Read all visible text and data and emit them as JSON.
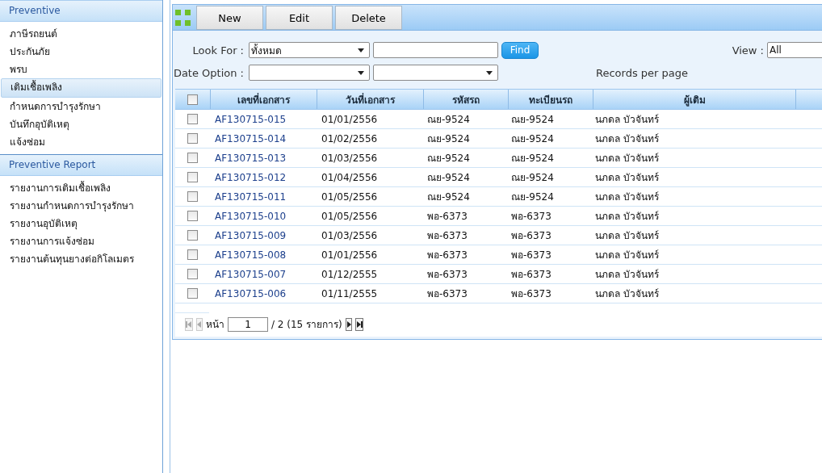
{
  "sidebar": {
    "sections": [
      {
        "title": "Preventive",
        "items": [
          {
            "label": "ภาษีรถยนต์",
            "selected": false
          },
          {
            "label": "ประกันภัย",
            "selected": false
          },
          {
            "label": "พรบ",
            "selected": false
          },
          {
            "label": "เติมเชื้อเพลิง",
            "selected": true
          },
          {
            "label": "กำหนดการบำรุงรักษา",
            "selected": false
          },
          {
            "label": "บันทึกอุบัติเหตุ",
            "selected": false
          },
          {
            "label": "แจ้งซ่อม",
            "selected": false
          }
        ]
      },
      {
        "title": "Preventive Report",
        "items": [
          {
            "label": "รายงานการเติมเชื้อเพลิง",
            "selected": false
          },
          {
            "label": "รายงานกำหนดการบำรุงรักษา",
            "selected": false
          },
          {
            "label": "รายงานอุบัติเหตุ",
            "selected": false
          },
          {
            "label": "รายงานการแจ้งซ่อม",
            "selected": false
          },
          {
            "label": "รายงานต้นทุนยางต่อกิโลเมตร",
            "selected": false
          }
        ]
      }
    ]
  },
  "toolbar": {
    "buttons": [
      "New",
      "Edit",
      "Delete"
    ]
  },
  "filters": {
    "look_for": {
      "label": "Look For :",
      "value": "ทั้งหมด"
    },
    "find_button": "Find",
    "date_option": {
      "label": "Date Option :"
    },
    "view": {
      "label": "View :",
      "value": "All"
    },
    "records_per_page": "Records per page"
  },
  "table": {
    "columns": [
      "เลขที่เอกสาร",
      "วันที่เอกสาร",
      "รหัสรถ",
      "ทะเบียนรถ",
      "ผู้เติม"
    ],
    "header_checked": false,
    "rows": [
      {
        "checked": false,
        "cells": [
          "AF130715-015",
          "01/01/2556",
          "ณย-9524",
          "ณย-9524",
          "นภดล บัวจันทร์"
        ]
      },
      {
        "checked": false,
        "cells": [
          "AF130715-014",
          "01/02/2556",
          "ณย-9524",
          "ณย-9524",
          "นภดล บัวจันทร์"
        ]
      },
      {
        "checked": false,
        "cells": [
          "AF130715-013",
          "01/03/2556",
          "ณย-9524",
          "ณย-9524",
          "นภดล บัวจันทร์"
        ]
      },
      {
        "checked": false,
        "cells": [
          "AF130715-012",
          "01/04/2556",
          "ณย-9524",
          "ณย-9524",
          "นภดล บัวจันทร์"
        ]
      },
      {
        "checked": false,
        "cells": [
          "AF130715-011",
          "01/05/2556",
          "ณย-9524",
          "ณย-9524",
          "นภดล บัวจันทร์"
        ]
      },
      {
        "checked": false,
        "cells": [
          "AF130715-010",
          "01/05/2556",
          "พอ-6373",
          "พอ-6373",
          "นภดล บัวจันทร์"
        ]
      },
      {
        "checked": false,
        "cells": [
          "AF130715-009",
          "01/03/2556",
          "พอ-6373",
          "พอ-6373",
          "นภดล บัวจันทร์"
        ]
      },
      {
        "checked": false,
        "cells": [
          "AF130715-008",
          "01/01/2556",
          "พอ-6373",
          "พอ-6373",
          "นภดล บัวจันทร์"
        ]
      },
      {
        "checked": false,
        "cells": [
          "AF130715-007",
          "01/12/2555",
          "พอ-6373",
          "พอ-6373",
          "นภดล บัวจันทร์"
        ]
      },
      {
        "checked": false,
        "cells": [
          "AF130715-006",
          "01/11/2555",
          "พอ-6373",
          "พอ-6373",
          "นภดล บัวจันทร์"
        ]
      }
    ]
  },
  "pager": {
    "first_disabled": true,
    "prev_disabled": true,
    "next_disabled": false,
    "last_disabled": false,
    "page_label": "หน้า",
    "page": "1",
    "total": "/ 2 (15 รายการ)"
  }
}
